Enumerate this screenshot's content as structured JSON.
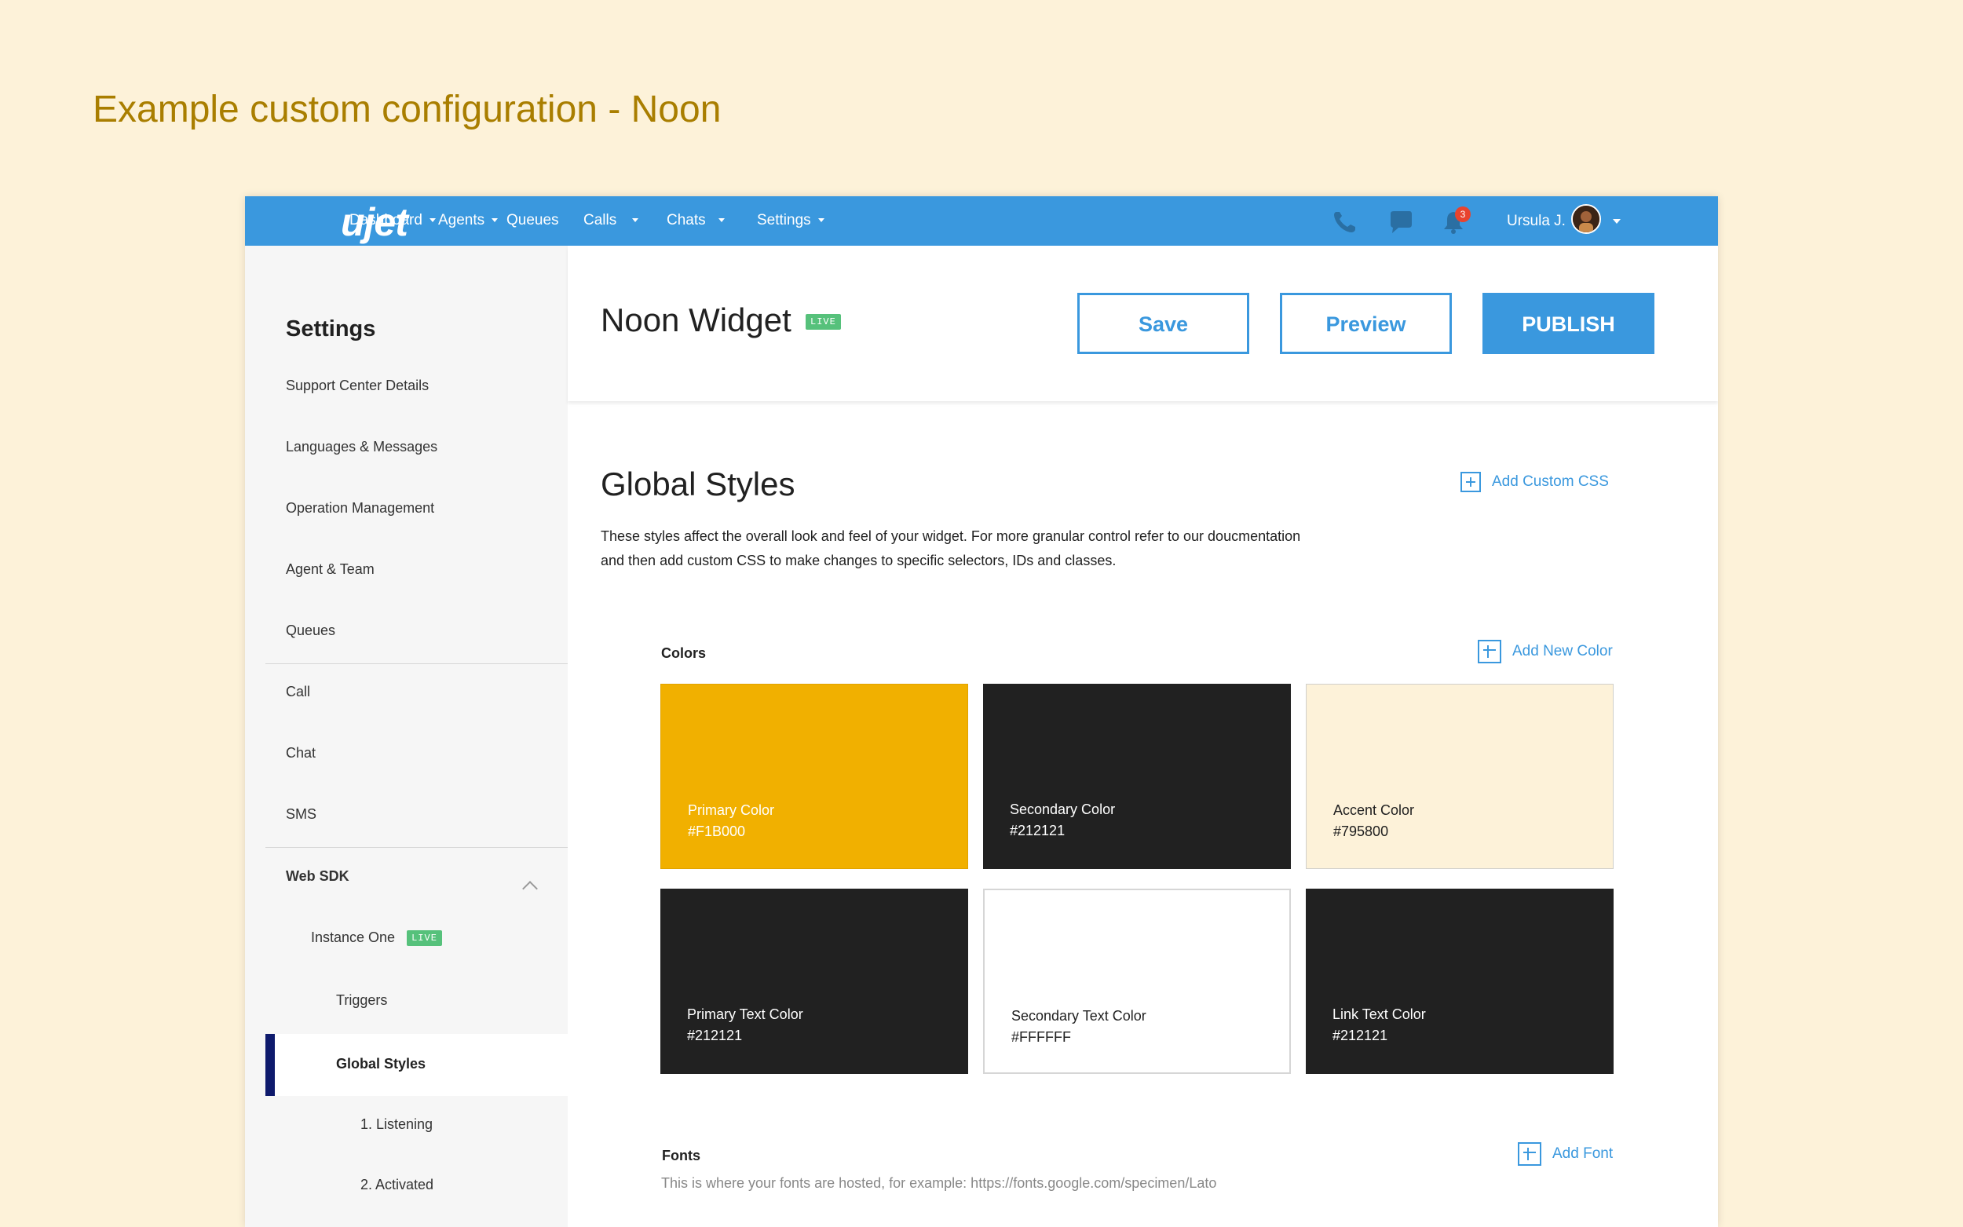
{
  "page_title": "Example custom configuration - Noon",
  "nav": {
    "logo": "ujet",
    "items": [
      {
        "label": "Dashboard",
        "caret": true
      },
      {
        "label": "Agents",
        "caret": true
      },
      {
        "label": "Queues",
        "caret": false
      },
      {
        "label": "Calls",
        "caret": true
      },
      {
        "label": "Chats",
        "caret": true
      },
      {
        "label": "Settings",
        "caret": true
      }
    ],
    "icons": [
      "phone-icon",
      "chat-bubble-icon",
      "bell-icon"
    ],
    "notification_count": "3",
    "user_name": "Ursula J."
  },
  "sidebar": {
    "heading": "Settings",
    "items": [
      "Support Center Details",
      "Languages & Messages",
      "Operation Management",
      "Agent & Team",
      "Queues",
      "Call",
      "Chat",
      "SMS",
      "Web SDK",
      "Instance One",
      "Triggers",
      "Global Styles",
      "1. Listening",
      "2. Activated"
    ],
    "live_badge": "LIVE"
  },
  "header": {
    "widget_title": "Noon Widget",
    "live_badge": "LIVE",
    "save_label": "Save",
    "preview_label": "Preview",
    "publish_label": "PUBLISH"
  },
  "global_styles": {
    "title": "Global Styles",
    "add_css_label": "Add Custom CSS",
    "description_line1": "These styles affect the overall look and feel of your widget. For more granular control refer to our doucmentation",
    "description_line2": "and then add custom CSS to make changes to specific selectors, IDs and classes."
  },
  "colors": {
    "heading": "Colors",
    "add_label": "Add New Color",
    "swatches": [
      {
        "name": "Primary Color",
        "hex": "#F1B000",
        "bg": "#F1B000",
        "text": "#FFFFFF"
      },
      {
        "name": "Secondary Color",
        "hex": "#212121",
        "bg": "#212121",
        "text": "#FFFFFF"
      },
      {
        "name": "Accent Color",
        "hex": "#795800",
        "bg": "#FDF2D9",
        "text": "#212121"
      },
      {
        "name": "Primary Text Color",
        "hex": "#212121",
        "bg": "#212121",
        "text": "#FFFFFF"
      },
      {
        "name": "Secondary Text Color",
        "hex": "#FFFFFF",
        "bg": "#FFFFFF",
        "text": "#212121"
      },
      {
        "name": "Link Text Color",
        "hex": "#212121",
        "bg": "#212121",
        "text": "#FFFFFF"
      }
    ]
  },
  "fonts": {
    "heading": "Fonts",
    "add_label": "Add Font",
    "description": "This is where your fonts are hosted, for example: https://fonts.google.com/specimen/Lato"
  },
  "theme": {
    "brand_blue": "#3A98DE",
    "page_bg": "#FDF2D9",
    "live_green": "#56C17B",
    "active_bar": "#0E1A6C"
  }
}
